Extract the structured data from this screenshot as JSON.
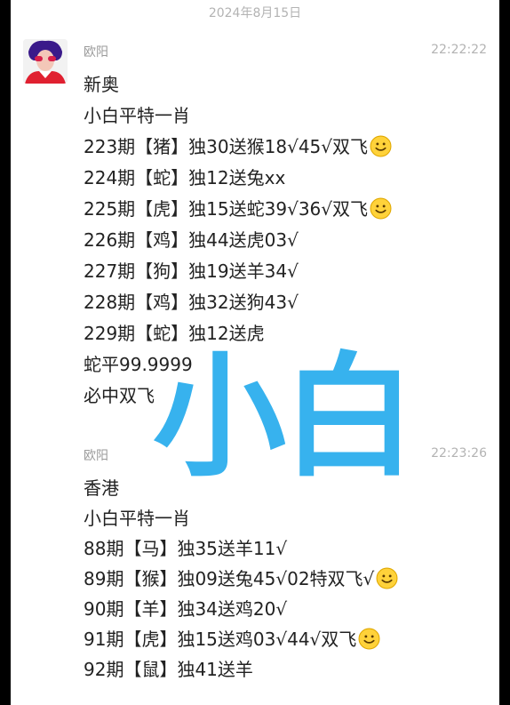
{
  "date_divider": "2024年8月15日",
  "watermark": "小白",
  "messages": [
    {
      "sender": "欧阳",
      "time": "22:22:22",
      "lines": [
        {
          "text": "新奥",
          "emoji": false
        },
        {
          "text": "小白平特一肖",
          "emoji": false
        },
        {
          "text": "223期【猪】独30送猴18√45√双飞",
          "emoji": true
        },
        {
          "text": "224期【蛇】独12送兔xx",
          "emoji": false
        },
        {
          "text": "225期【虎】独15送蛇39√36√双飞",
          "emoji": true
        },
        {
          "text": "226期【鸡】独44送虎03√",
          "emoji": false
        },
        {
          "text": "227期【狗】独19送羊34√",
          "emoji": false
        },
        {
          "text": "228期【鸡】独32送狗43√",
          "emoji": false
        },
        {
          "text": "229期【蛇】独12送虎",
          "emoji": false
        },
        {
          "text": "蛇平99.9999",
          "emoji": false
        },
        {
          "text": "必中双飞",
          "emoji": false
        }
      ]
    },
    {
      "sender": "欧阳",
      "time": "22:23:26",
      "lines": [
        {
          "text": "香港",
          "emoji": false
        },
        {
          "text": "小白平特一肖",
          "emoji": false
        },
        {
          "text": "88期【马】独35送羊11√",
          "emoji": false
        },
        {
          "text": "89期【猴】独09送兔45√02特双飞√",
          "emoji": true
        },
        {
          "text": "90期【羊】独34送鸡20√",
          "emoji": false
        },
        {
          "text": "91期【虎】独15送鸡03√44√双飞",
          "emoji": true
        },
        {
          "text": "92期【鼠】独41送羊",
          "emoji": false
        }
      ]
    }
  ],
  "colors": {
    "watermark": "#14a5eb",
    "text": "#222222",
    "meta": "#b3b3b3"
  }
}
